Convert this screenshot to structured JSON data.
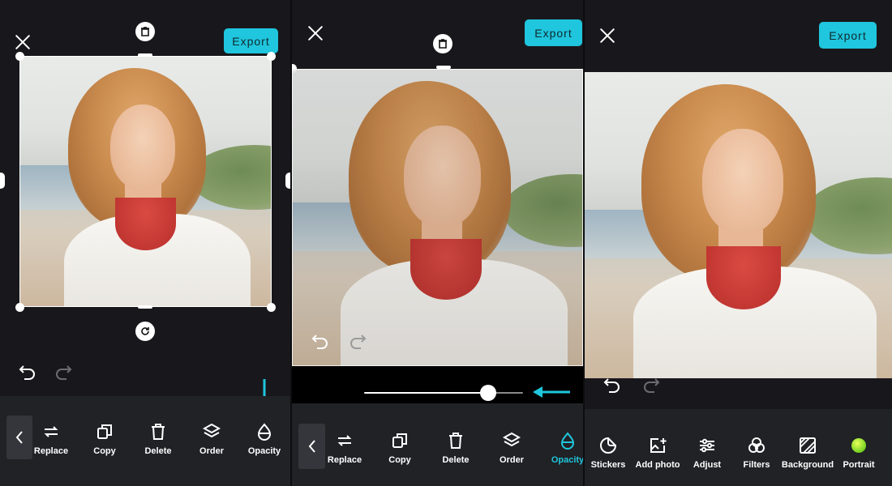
{
  "export_label": "Export",
  "colors": {
    "accent": "#1fc6dd",
    "toolbar_bg": "#202226",
    "panel_bg": "#18181c"
  },
  "screen1": {
    "tools": [
      {
        "label": "Replace",
        "icon": "replace-icon"
      },
      {
        "label": "Copy",
        "icon": "copy-icon"
      },
      {
        "label": "Delete",
        "icon": "delete-icon"
      },
      {
        "label": "Order",
        "icon": "order-icon"
      },
      {
        "label": "Opacity",
        "icon": "opacity-icon"
      }
    ]
  },
  "screen2": {
    "tools": [
      {
        "label": "Replace",
        "icon": "replace-icon"
      },
      {
        "label": "Copy",
        "icon": "copy-icon"
      },
      {
        "label": "Delete",
        "icon": "delete-icon"
      },
      {
        "label": "Order",
        "icon": "order-icon"
      },
      {
        "label": "Opacity",
        "icon": "opacity-icon",
        "active": true
      }
    ],
    "opacity_value": 0.78
  },
  "screen3": {
    "tools": [
      {
        "label": "Stickers",
        "icon": "sticker-icon"
      },
      {
        "label": "Add photo",
        "icon": "add-photo-icon"
      },
      {
        "label": "Adjust",
        "icon": "adjust-icon"
      },
      {
        "label": "Filters",
        "icon": "filters-icon"
      },
      {
        "label": "Background",
        "icon": "background-icon"
      },
      {
        "label": "Portrait",
        "icon": "portrait-icon"
      }
    ]
  }
}
